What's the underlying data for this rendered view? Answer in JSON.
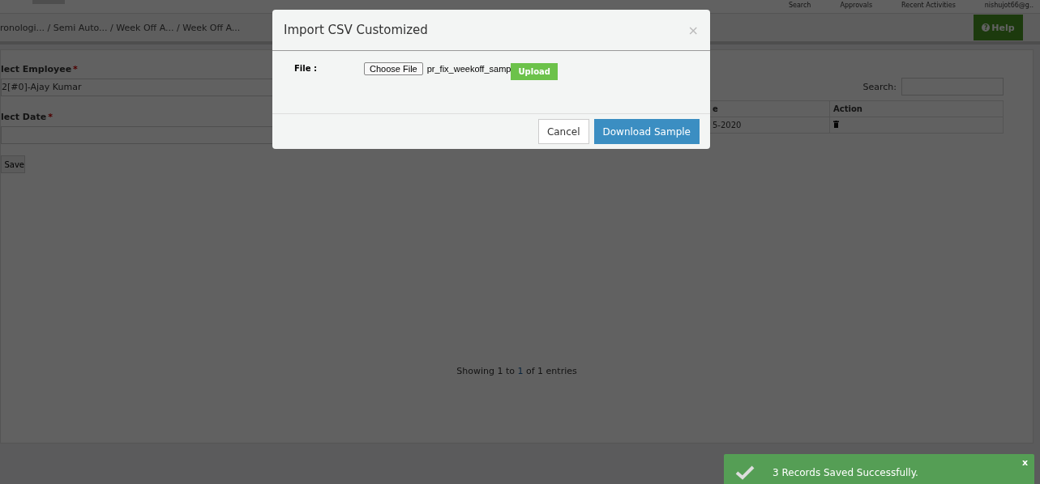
{
  "top_nav": [
    "Search",
    "Approvals",
    "Recent Activities",
    "nishujot66@g.."
  ],
  "breadcrumb": "ronologi... / Semi Auto... / Week Off A... / Week Off A...",
  "help_button": {
    "icon": "?",
    "label": "Help"
  },
  "form": {
    "fields": [
      {
        "label": "lect Employee",
        "required_mark": "*",
        "value": "2[#0]-Ajay Kumar"
      },
      {
        "label": "lect Date",
        "required_mark": "*"
      }
    ],
    "save_button": "Save"
  },
  "table": {
    "search_label": "Search:",
    "columns": [
      "e",
      "Action"
    ],
    "rows": [
      [
        "5-2020"
      ]
    ],
    "info": {
      "before": "Showing 1 to ",
      "range": "1",
      "after": " of 1 entries"
    }
  },
  "modal": {
    "title": "Import CSV Customized",
    "close": "×",
    "file_label": "File :",
    "choose_button": "Choose File",
    "file_name": "pr_fix_weekoff_samp",
    "upload_button": "Upload",
    "cancel_button": "Cancel",
    "download_button": "Download Sample"
  },
  "toast": {
    "message": "3 Records Saved Successfully.",
    "close": "x"
  }
}
